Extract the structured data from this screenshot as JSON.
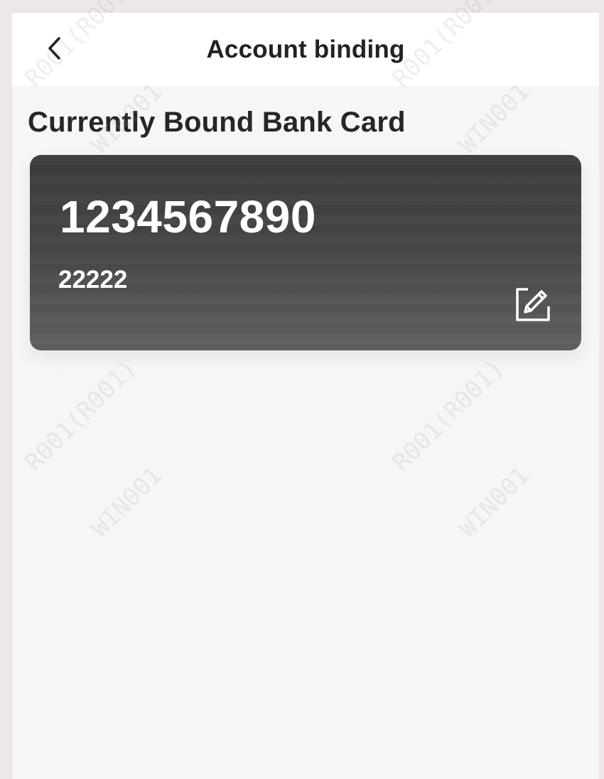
{
  "header": {
    "title": "Account binding"
  },
  "section": {
    "title": "Currently Bound Bank Card"
  },
  "card": {
    "number": "1234567890",
    "holder": "22222"
  },
  "watermark": {
    "line1": "R001(R001)",
    "line2": "WIN001"
  },
  "icons": {
    "back": "chevron-left-icon",
    "edit": "edit-icon"
  },
  "colors": {
    "card_gradient_top": "#3b3c3a",
    "card_gradient_bottom": "#5f605f",
    "page_background": "#f6f6f6"
  }
}
